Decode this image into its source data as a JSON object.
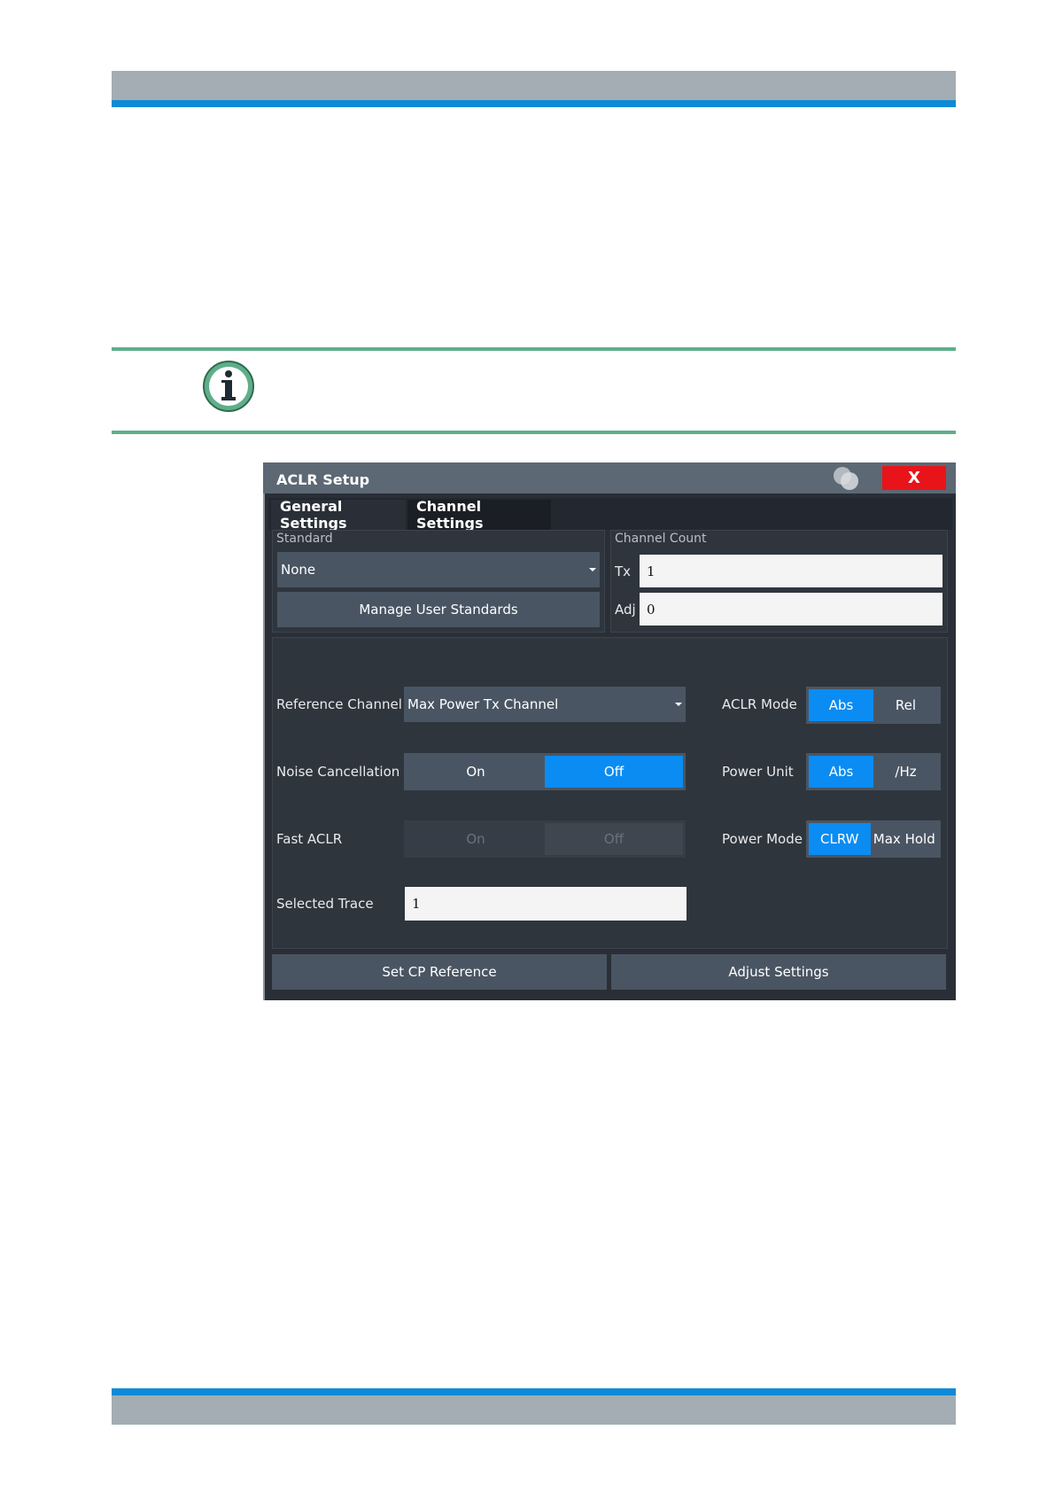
{
  "dialog": {
    "title": "ACLR Setup",
    "close_label": "X",
    "tabs": [
      {
        "label": "General Settings",
        "active": false
      },
      {
        "label": "Channel Settings",
        "active": true
      }
    ]
  },
  "standard": {
    "section_label": "Standard",
    "value": "None",
    "manage_button": "Manage User Standards"
  },
  "channel_count": {
    "section_label": "Channel Count",
    "tx_label": "Tx",
    "tx_value": "1",
    "adj_label": "Adj",
    "adj_value": "0"
  },
  "reference_channel": {
    "label": "Reference Channel",
    "value": "Max Power Tx Channel"
  },
  "noise_cancellation": {
    "label": "Noise Cancellation",
    "on": "On",
    "off": "Off",
    "selected": "Off"
  },
  "fast_aclr": {
    "label": "Fast ACLR",
    "on": "On",
    "off": "Off",
    "selected": "Off",
    "enabled": false
  },
  "selected_trace": {
    "label": "Selected Trace",
    "value": "1"
  },
  "aclr_mode": {
    "label": "ACLR Mode",
    "opt1": "Abs",
    "opt2": "Rel",
    "selected": "Abs"
  },
  "power_unit": {
    "label": "Power Unit",
    "opt1": "Abs",
    "opt2": "/Hz",
    "selected": "Abs"
  },
  "power_mode": {
    "label": "Power Mode",
    "opt1": "CLRW",
    "opt2": "Max Hold",
    "selected": "CLRW"
  },
  "footer": {
    "set_cp_reference": "Set CP Reference",
    "adjust_settings": "Adjust Settings"
  },
  "colors": {
    "accent_blue": "#0a8cf2",
    "close_red": "#e8141a",
    "note_green": "#5fae8a",
    "brand_blue": "#0e8ad6"
  },
  "icons": {
    "info": "info-icon",
    "bubbles": "bubbles-icon",
    "dropdown": "chevron-down-icon"
  }
}
